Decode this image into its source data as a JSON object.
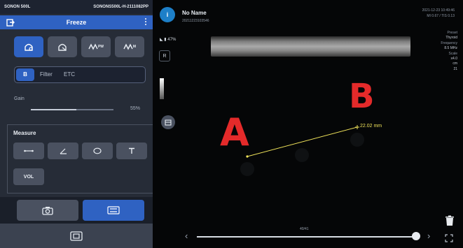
{
  "app": {
    "device_name": "SONON 500L",
    "device_serial": "SONONS500L-H-2111082PP"
  },
  "freeze": {
    "label": "Freeze"
  },
  "modes": [
    {
      "label": "",
      "icon": "b-mode-probe-icon",
      "active": true
    },
    {
      "label": "",
      "icon": "color-doppler-icon",
      "active": false
    },
    {
      "label": "PW",
      "icon": "pulse-wave-icon",
      "active": false
    },
    {
      "label": "M",
      "icon": "m-mode-wave-icon",
      "active": false
    }
  ],
  "filter_row": {
    "b_label": "B",
    "filter_label": "Filter",
    "etc_label": "ETC"
  },
  "gain": {
    "label": "Gain",
    "value_text": "55%",
    "value": 0.55
  },
  "measure": {
    "title": "Measure",
    "tools": [
      {
        "icon": "distance-icon"
      },
      {
        "icon": "angle-icon"
      },
      {
        "icon": "ellipse-icon"
      },
      {
        "icon": "trace-icon"
      },
      {
        "label": "VOL"
      }
    ]
  },
  "bottom": {
    "camera_icon": "camera-icon",
    "swap_icon": "screen-swap-icon",
    "capture_icon": "capture-frame-icon"
  },
  "image": {
    "info_icon": "info-icon",
    "patient_name": "No Name",
    "patient_id": "20211223103546",
    "battery": "47%",
    "r_label": "R",
    "datetime_line1": "2021-12-23 10:49:46",
    "datetime_line2": "MI 0.67 / TIS 0.13",
    "params": [
      {
        "label": "Preset",
        "value": "Thyroid"
      },
      {
        "label": "Frequency",
        "value": "8.5 MHz"
      },
      {
        "label": "Scale",
        "value": "x4.0"
      },
      {
        "label": "",
        "value": "cm"
      },
      {
        "label": "",
        "value": "21"
      }
    ],
    "letter_a": "A",
    "letter_b": "B",
    "measurement": "22.02 mm",
    "frames": "40/41"
  },
  "colors": {
    "accent": "#2f62c2",
    "panel": "#262c37",
    "annotation_red": "#e42a2a",
    "measure_yellow": "#f0e35a"
  }
}
